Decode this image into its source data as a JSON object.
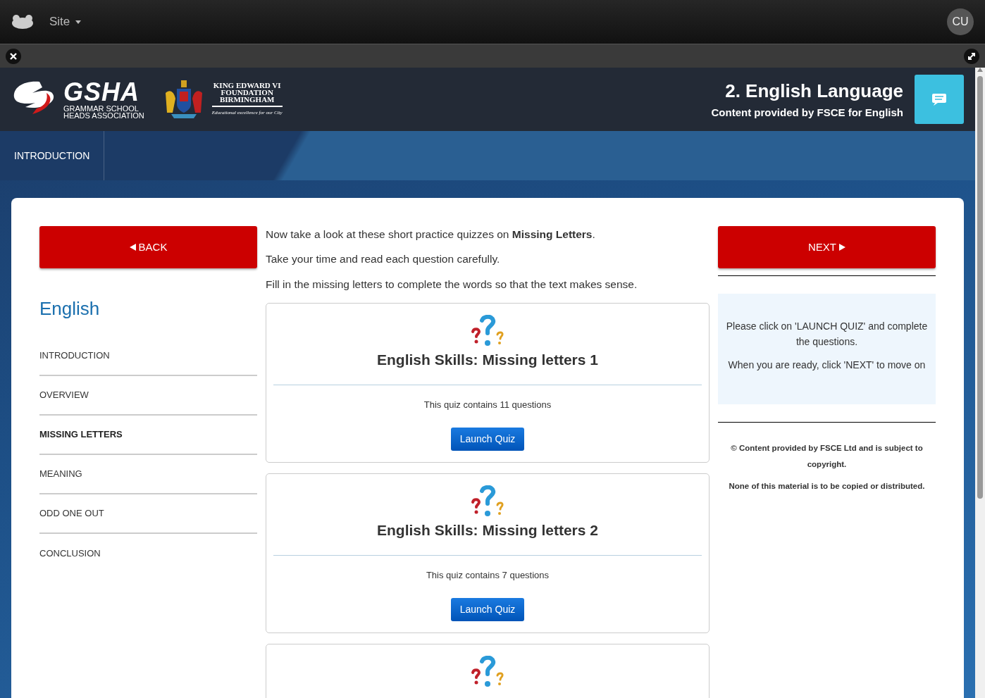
{
  "topbar": {
    "site_menu": "Site",
    "user_initials": "CU"
  },
  "header": {
    "logo_text": "GSHA",
    "logo_sub": [
      "GRAMMAR SCHOOL",
      "HEADS ASSOCIATION"
    ],
    "crest_lines": [
      "KING EDWARD VI",
      "FOUNDATION",
      "BIRMINGHAM"
    ],
    "crest_motto": "Educational excellence for our City",
    "title": "2. English Language",
    "subtitle": "Content provided by FSCE for English"
  },
  "nav_tabs": [
    {
      "label": "INTRODUCTION",
      "selected": true
    }
  ],
  "back_button": "BACK",
  "next_button": "NEXT",
  "sidebar": {
    "title": "English",
    "items": [
      {
        "label": "INTRODUCTION",
        "selected": false
      },
      {
        "label": "OVERVIEW",
        "selected": false
      },
      {
        "label": "MISSING LETTERS",
        "selected": true
      },
      {
        "label": "MEANING",
        "selected": false
      },
      {
        "label": "ODD ONE OUT",
        "selected": false
      },
      {
        "label": "CONCLUSION",
        "selected": false
      }
    ]
  },
  "intro": [
    "Now take a look at these short practice quizzes on **Missing Letters**.",
    "Take your time and read each question carefully.",
    "Fill in the missing letters to complete the words so that the text makes sense."
  ],
  "quizzes": [
    {
      "kind": "full",
      "title": "English Skills: Missing letters 1",
      "info": "This quiz contains 11 questions",
      "button": "Launch Quiz"
    },
    {
      "kind": "full",
      "title": "English Skills: Missing letters 2",
      "info": "This quiz contains 7 questions",
      "button": "Launch Quiz"
    },
    {
      "kind": "partial"
    }
  ],
  "instructions": [
    "Please click on 'LAUNCH QUIZ' and complete the questions.",
    "When you are ready, click 'NEXT' to move on"
  ],
  "copyright": [
    "© Content provided by FSCE Ltd and is subject to copyright.",
    "None of this material is to be copied or distributed."
  ]
}
